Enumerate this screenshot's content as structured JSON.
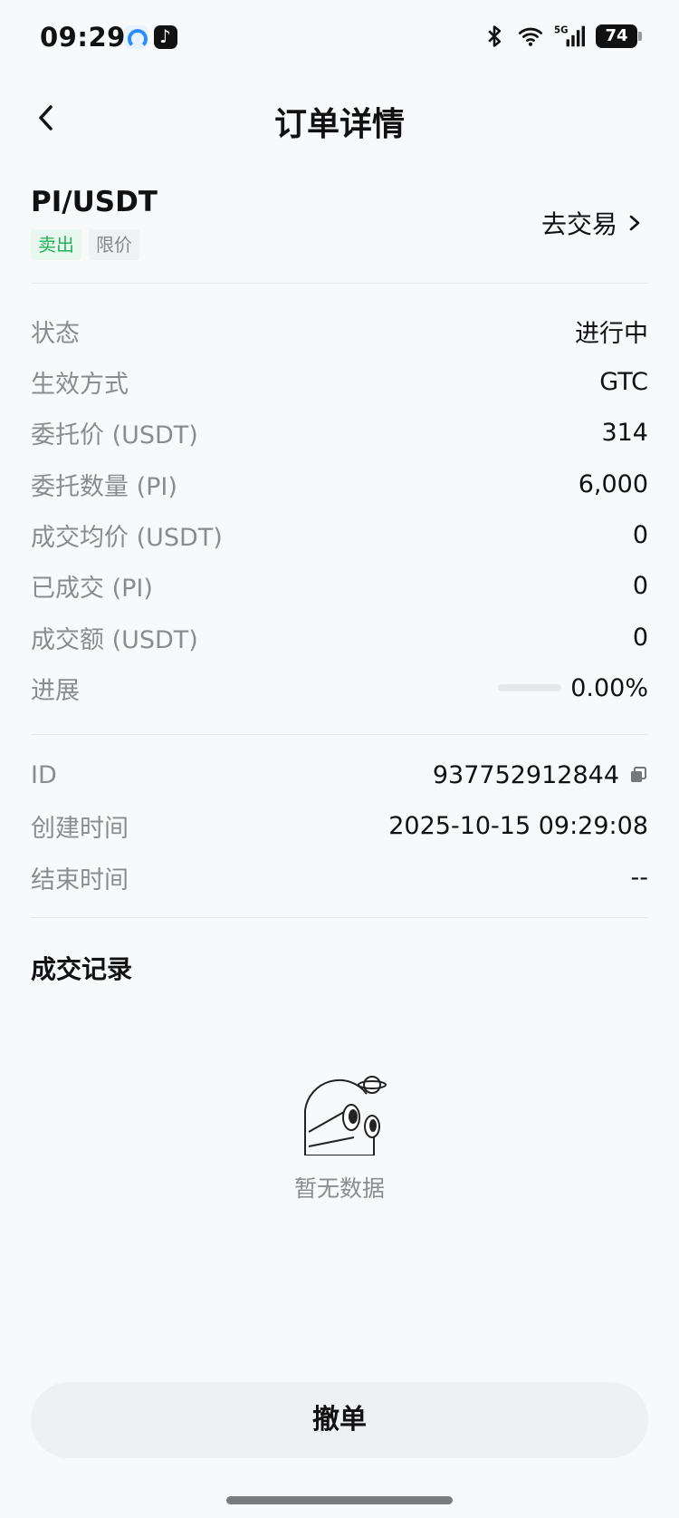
{
  "status_bar": {
    "time": "09:29",
    "battery": "74",
    "network": "5G",
    "icons": [
      "bluetooth-icon",
      "wifi-icon",
      "signal-icon",
      "battery-icon"
    ]
  },
  "header": {
    "title": "订单详情",
    "back_icon": "chevron-left-icon"
  },
  "pair": {
    "symbol": "PI/USDT",
    "side_tag": "卖出",
    "type_tag": "限价",
    "go_trade": "去交易"
  },
  "details": [
    {
      "label": "状态",
      "value": "进行中"
    },
    {
      "label": "生效方式",
      "value": "GTC"
    },
    {
      "label": "委托价 (USDT)",
      "value": "314"
    },
    {
      "label": "委托数量 (PI)",
      "value": "6,000"
    },
    {
      "label": "成交均价 (USDT)",
      "value": "0"
    },
    {
      "label": "已成交 (PI)",
      "value": "0"
    },
    {
      "label": "成交额 (USDT)",
      "value": "0"
    }
  ],
  "progress": {
    "label": "进展",
    "value": "0.00%",
    "fraction": 0
  },
  "meta": {
    "id_label": "ID",
    "id_value": "937752912844",
    "created_label": "创建时间",
    "created_value": "2025-10-15 09:29:08",
    "ended_label": "结束时间",
    "ended_value": "--"
  },
  "records": {
    "title": "成交记录",
    "empty_text": "暂无数据"
  },
  "actions": {
    "cancel": "撤单"
  },
  "colors": {
    "sell_green": "#20b15a",
    "sell_bg": "#e8f8ee",
    "muted": "#8a8c90",
    "button_bg": "#eef0f3"
  }
}
